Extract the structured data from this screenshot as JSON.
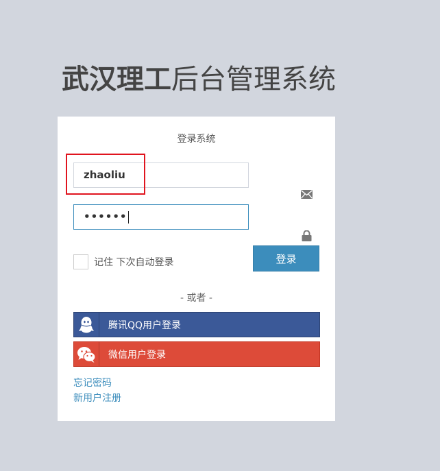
{
  "page_title": {
    "bold": "武汉理工",
    "rest": "后台管理系统"
  },
  "login_box": {
    "message": "登录系统",
    "username_value": "zhaoliu",
    "password_mask": "••••••",
    "remember_label": "记住 下次自动登录",
    "signin_label": "登录",
    "divider": "- 或者 -",
    "qq_label": "腾讯QQ用户登录",
    "wechat_label": "微信用户登录",
    "forgot_label": "忘记密码",
    "register_label": "新用户注册"
  },
  "icons": {
    "username_field": "envelope-icon",
    "password_field": "lock-icon",
    "qq": "qq-icon",
    "wechat": "wechat-icon"
  },
  "colors": {
    "background": "#d2d6de",
    "primary": "#3c8dbc",
    "qq": "#3b5998",
    "wechat": "#dd4b39",
    "highlight": "#e0141e"
  }
}
